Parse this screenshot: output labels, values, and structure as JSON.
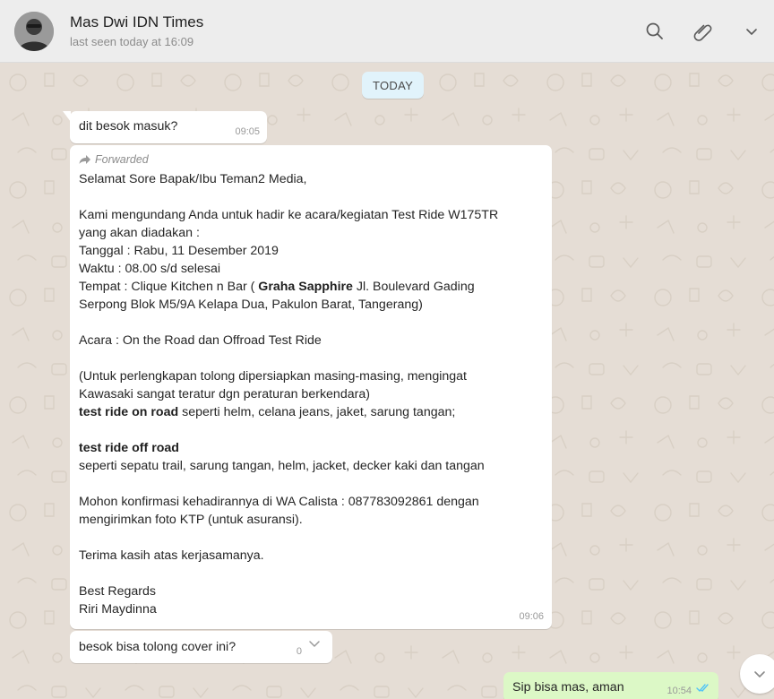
{
  "header": {
    "contact_name": "Mas Dwi IDN Times",
    "last_seen": "last seen today at 16:09",
    "icons": [
      "search-icon",
      "attach-icon",
      "menu-chevron-icon"
    ]
  },
  "chat": {
    "date_label": "TODAY",
    "messages": [
      {
        "direction": "incoming",
        "text": "dit besok masuk?",
        "time": "09:05"
      },
      {
        "direction": "incoming",
        "forwarded_label": "Forwarded",
        "time": "09:06",
        "lines": {
          "l1": "Selamat Sore Bapak/Ibu Teman2 Media,",
          "l2": "Kami mengundang Anda untuk hadir ke acara/kegiatan Test Ride W175TR",
          "l3": "yang akan diadakan :",
          "l4": "Tanggal : Rabu, 11 Desember 2019",
          "l5": "Waktu : 08.00 s/d selesai",
          "l6_pre": "Tempat : Clique Kitchen n Bar ( ",
          "l6_bold": "Graha Sapphire",
          "l6_post": " Jl. Boulevard Gading",
          "l7": "Serpong Blok M5/9A Kelapa Dua, Pakulon Barat, Tangerang)",
          "l8": "Acara : On the Road dan Offroad Test Ride",
          "l9": "(Untuk perlengkapan tolong dipersiapkan masing-masing, mengingat",
          "l10": "Kawasaki sangat teratur dgn peraturan berkendara)",
          "l11_bold": "test ride on road",
          "l11_post": " seperti helm, celana jeans, jaket, sarung tangan;",
          "l12_bold": "test ride off road",
          "l13": "seperti sepatu trail, sarung tangan, helm, jacket, decker kaki dan tangan",
          "l14": "Mohon konfirmasi kehadirannya di WA Calista : 087783092861 dengan",
          "l15": "mengirimkan foto KTP (untuk asuransi).",
          "l16": "Terima kasih atas kerjasamanya.",
          "l17": "Best Regards",
          "l18": "Riri Maydinna"
        }
      },
      {
        "direction": "incoming",
        "text": "besok bisa tolong cover ini?",
        "time": "0"
      },
      {
        "direction": "outgoing",
        "text": "Sip bisa mas, aman",
        "time": "10:54",
        "status": "read"
      }
    ]
  },
  "colors": {
    "wallpaper": "#e5ddd5",
    "header_bg": "#ededed",
    "incoming_bubble": "#ffffff",
    "outgoing_bubble": "#dcf8c6",
    "date_pill": "#e1f3fb",
    "read_ticks": "#4fc3f7"
  }
}
